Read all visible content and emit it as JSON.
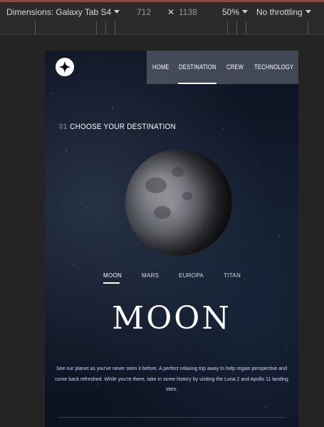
{
  "devtools": {
    "dimensions_label": "Dimensions: Galaxy Tab S4",
    "width_value": "712",
    "times_symbol": "✕",
    "height_value": "1138",
    "zoom": "50%",
    "throttling": "No throttling"
  },
  "site": {
    "logo_icon": "star-icon",
    "nav": [
      "HOME",
      "DESTINATION",
      "CREW",
      "TECHNOLOGY"
    ],
    "active_nav": "DESTINATION",
    "heading_number": "01",
    "heading_text": "CHOOSE YOUR DESTINATION",
    "tabs": [
      "MOON",
      "MARS",
      "EUROPA",
      "TITAN"
    ],
    "active_tab": "MOON",
    "destination_name": "MOON",
    "description": "See our planet as you've never seen it before. A perfect relaxing trip away to help regain perspective and come back refreshed. While you're there, take in some history by visiting the Luna 2 and Apollo 11 landing sites."
  }
}
